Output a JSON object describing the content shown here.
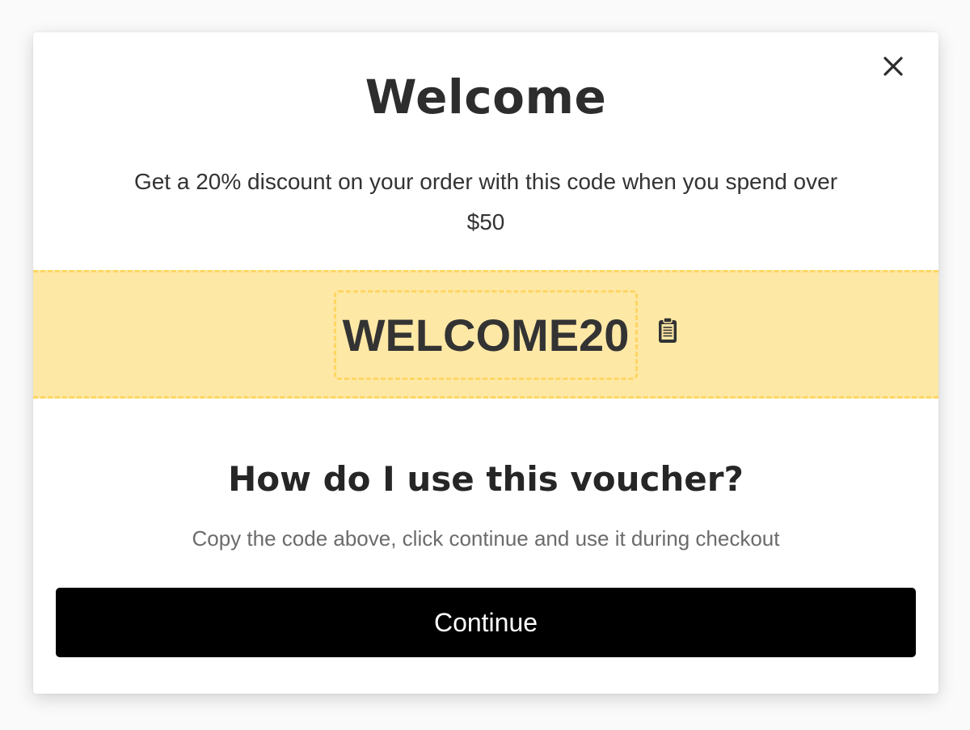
{
  "modal": {
    "title": "Welcome",
    "subtitle": "Get a 20% discount on your order with this code when you spend over $50",
    "close_icon": "close-icon",
    "voucher": {
      "code": "WELCOME20",
      "copy_icon": "clipboard-icon",
      "band_color": "#fee8a5",
      "dash_color": "#fdd663"
    },
    "how_to": {
      "heading": "How do I use this voucher?",
      "instructions": "Copy the code above, click continue and use it during checkout"
    },
    "continue_label": "Continue",
    "button_color": "#000000"
  }
}
